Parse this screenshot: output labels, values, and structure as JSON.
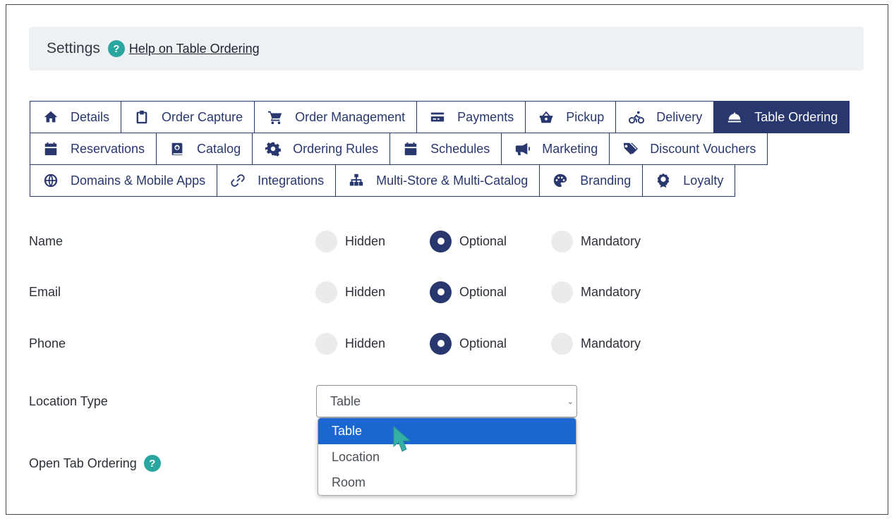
{
  "header": {
    "title": "Settings",
    "help_icon": "?",
    "help_link": "Help on Table Ordering"
  },
  "tabs": {
    "row1": [
      {
        "label": "Details",
        "icon": "home-icon"
      },
      {
        "label": "Order Capture",
        "icon": "clipboard-icon"
      },
      {
        "label": "Order Management",
        "icon": "cart-icon"
      },
      {
        "label": "Payments",
        "icon": "credit-card-icon"
      },
      {
        "label": "Pickup",
        "icon": "basket-icon"
      },
      {
        "label": "Delivery",
        "icon": "bicycle-icon"
      },
      {
        "label": "Table Ordering",
        "icon": "cloche-icon",
        "active": true
      }
    ],
    "row2": [
      {
        "label": "Reservations",
        "icon": "calendar-icon"
      },
      {
        "label": "Catalog",
        "icon": "book-icon"
      },
      {
        "label": "Ordering Rules",
        "icon": "gear-icon"
      },
      {
        "label": "Schedules",
        "icon": "calendar-icon"
      },
      {
        "label": "Marketing",
        "icon": "megaphone-icon"
      },
      {
        "label": "Discount Vouchers",
        "icon": "tags-icon"
      }
    ],
    "row3": [
      {
        "label": "Domains & Mobile Apps",
        "icon": "globe-icon"
      },
      {
        "label": "Integrations",
        "icon": "link-icon"
      },
      {
        "label": "Multi-Store & Multi-Catalog",
        "icon": "sitemap-icon"
      },
      {
        "label": "Branding",
        "icon": "palette-icon"
      },
      {
        "label": "Loyalty",
        "icon": "award-icon"
      }
    ]
  },
  "fields": [
    {
      "label": "Name",
      "options": [
        "Hidden",
        "Optional",
        "Mandatory"
      ],
      "selected": "Optional"
    },
    {
      "label": "Email",
      "options": [
        "Hidden",
        "Optional",
        "Mandatory"
      ],
      "selected": "Optional"
    },
    {
      "label": "Phone",
      "options": [
        "Hidden",
        "Optional",
        "Mandatory"
      ],
      "selected": "Optional"
    }
  ],
  "location_type": {
    "label": "Location Type",
    "value": "Table",
    "options": [
      "Table",
      "Location",
      "Room"
    ],
    "highlighted": "Table"
  },
  "open_tab": {
    "label": "Open Tab Ordering",
    "help_icon": "?"
  },
  "colors": {
    "navy": "#28386e",
    "teal": "#2aa6a0",
    "highlight_blue": "#1a67d2",
    "header_bg": "#eef1f4"
  }
}
